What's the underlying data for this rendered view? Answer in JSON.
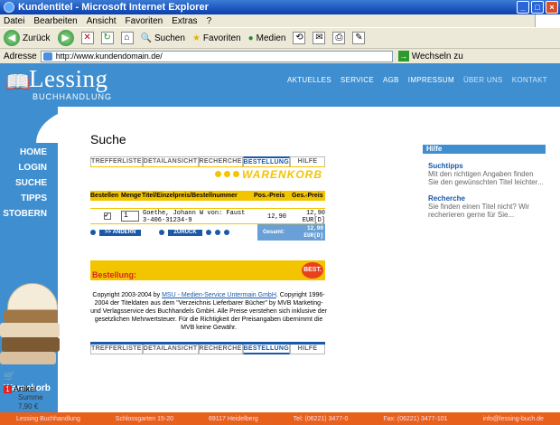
{
  "window": {
    "title": "Kundentitel - Microsoft Internet Explorer"
  },
  "menu": [
    "Datei",
    "Bearbeiten",
    "Ansicht",
    "Favoriten",
    "Extras",
    "?"
  ],
  "toolbar": {
    "back": "Zurück",
    "search": "Suchen",
    "favorites": "Favoriten",
    "media": "Medien"
  },
  "address": {
    "label": "Adresse",
    "url": "http://www.kundendomain.de/",
    "go": "Wechseln zu"
  },
  "header": {
    "logo_name": "Lessing",
    "logo_sub": "BUCHHANDLUNG",
    "nav": [
      "AKTUELLES",
      "SERVICE",
      "AGB",
      "IMPRESSUM",
      "ÜBER UNS",
      "KONTAKT"
    ]
  },
  "sidenav": [
    "HOME",
    "LOGIN",
    "SUCHE",
    "TIPPS",
    "STOBERN"
  ],
  "cart": {
    "title": "Warenkorb",
    "count": "1",
    "items_label": "Artikel",
    "sum_label": "Summe",
    "sum": "7,90 €"
  },
  "page": {
    "title": "Suche"
  },
  "tabs": [
    "TREFFERLISTE",
    "DETAILANSICHT",
    "RECHERCHE",
    "BESTELLUNG",
    "HILFE"
  ],
  "warenkorb_label": "WARENKORB",
  "table": {
    "headers": [
      "Bestellen",
      "Menge",
      "Titel/Einzelpreis/Bestellnummer",
      "Pos.-Preis",
      "Ges.-Preis"
    ],
    "row": {
      "qty": "1",
      "title_line1": "Goethe, Johann W von: Faust",
      "title_line2": "3-406-31234-9",
      "pos_price": "12,90",
      "total_line1": "12,90",
      "total_line2": "EUR[D]"
    }
  },
  "buttons": {
    "change": ">> ÄNDERN",
    "back": "ZURÜCK"
  },
  "gesamt": {
    "label": "Gesamt:",
    "value1": "12,90",
    "value2": "EUR[D]"
  },
  "bestellung": {
    "label": "Bestellung:",
    "icon_text": "BEST."
  },
  "copyright": {
    "line1_pre": "Copyright 2003-2004 by ",
    "link": "MSU - Medien-Service Untermain GmbH",
    "line1_post": ". Copyright",
    "rest": "1996-2004 der Titeldaten aus dem \"Verzeichnis Lieferbarer Bücher\" by MVB Marketing- und Verlagsservice des Buchhandels GmbH. Alle Preise verstehen sich inklusive der gesetzlichen Mehrwertsteuer. Für die Richtigkeit der Preisangaben übernimmt die MVB keine Gewähr."
  },
  "hilfe": {
    "title": "Hilfe",
    "items": [
      {
        "title": "Suchtipps",
        "text": "Mit den richtigen Angaben finden Sie den gewünschten Titel leichter..."
      },
      {
        "title": "Recherche",
        "text": "Sie finden einen Titel nicht? Wir recherieren gerne für Sie..."
      }
    ]
  },
  "footer": [
    "Lessing Buchhandlung",
    "Schlossgarten 15-20",
    "69117 Heidelberg",
    "Tel: (06221) 3477-0",
    "Fax: (06221) 3477-101",
    "info@lessing-buch.de"
  ]
}
